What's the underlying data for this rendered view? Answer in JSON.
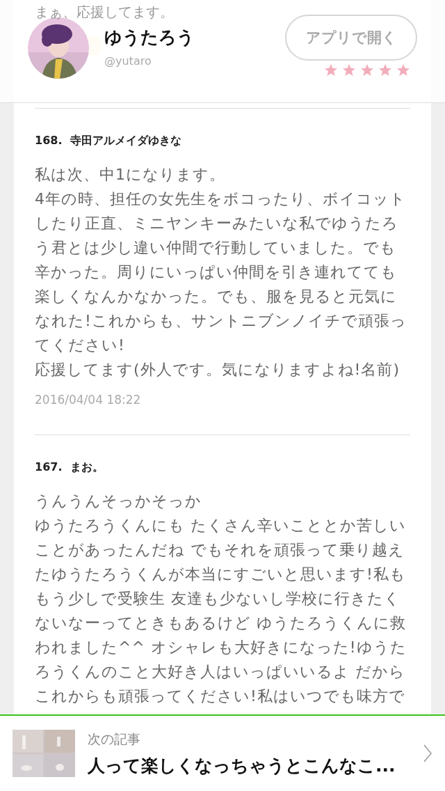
{
  "header": {
    "name": "ゆうたろう",
    "handle": "@yutaro",
    "open_app_button": "アプリで開く"
  },
  "previous_comment": {
    "text": "まぁ、応援してます。",
    "stars": 5
  },
  "comments": [
    {
      "number": "168.",
      "author": "寺田アルメイダゆきな",
      "body": [
        "私は次、中1になります。",
        "4年の時、担任の女先生をボコったり、ボイコットしたり正直、ミニヤンキーみたいな私でゆうたろう君とは少し違い仲間で行動していました。でも辛かった。周りにいっぱい仲間を引き連れてても楽しくなんかなかった。でも、服を見ると元気になれた!これからも、サントニブンノイチで頑張ってください!",
        "応援してます(外人です。気になりますよね!名前)"
      ],
      "date": "2016/04/04 18:22"
    },
    {
      "number": "167.",
      "author": "まお。",
      "body": [
        "うんうんそっかそっか",
        "ゆうたろうくんにも たくさん辛いこととか苦しいことがあったんだね でもそれを頑張って乗り越えたゆうたろうくんが本当にすごいと思います!私ももう少しで受験生 友達も少ないし学校に行きたくないなーってときもあるけど ゆうたろうくんに救われました^^ オシャレも大好きになった!ゆうたろうくんのこと大好き人はいっぱいいるよ だからこれからも頑張ってください!私はいつでも味方で"
      ]
    }
  ],
  "next_article": {
    "label": "次の記事",
    "title": "人って楽しくなっちゃうとこんなこ..."
  }
}
